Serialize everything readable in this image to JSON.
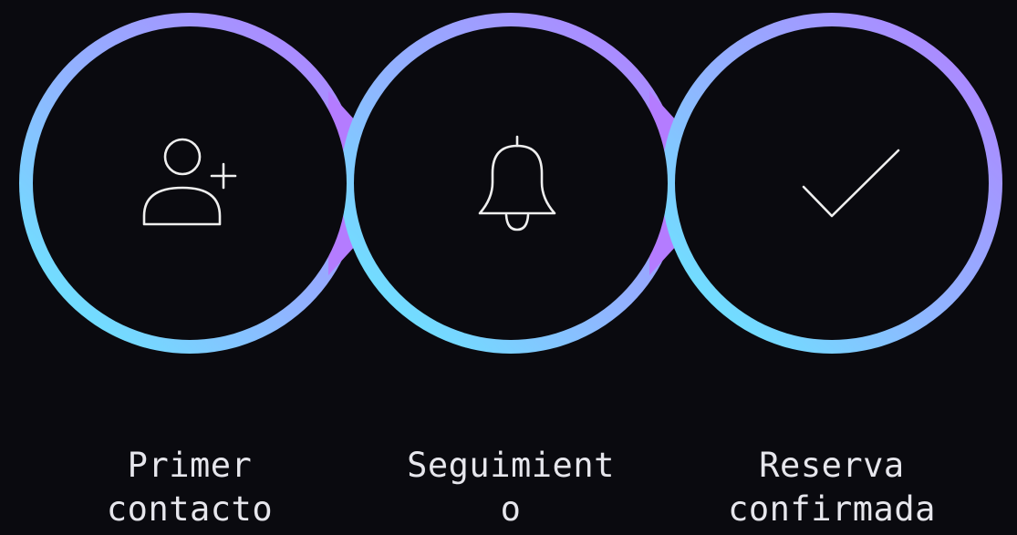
{
  "steps": [
    {
      "icon": "user-plus-icon",
      "label_lines": [
        "Primer",
        "contacto"
      ]
    },
    {
      "icon": "bell-icon",
      "label_lines": [
        "Seguimient",
        "o"
      ]
    },
    {
      "icon": "checkmark-icon",
      "label_lines": [
        "Reserva",
        "confirmada"
      ]
    }
  ],
  "colors": {
    "background": "#0a0a0f",
    "gradient_start": "#63f0ff",
    "gradient_mid": "#8fb6ff",
    "gradient_end": "#b47cff",
    "icon_stroke": "#efefef",
    "label_text": "#e6e6ec"
  }
}
